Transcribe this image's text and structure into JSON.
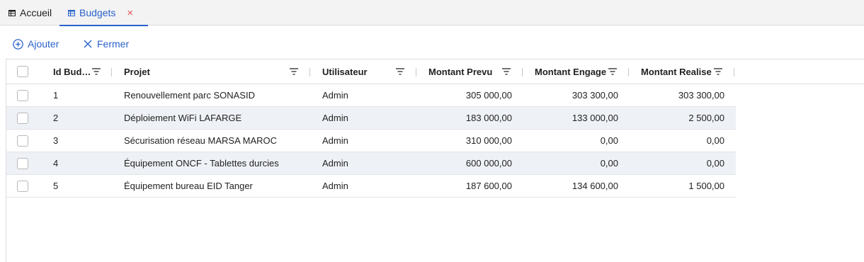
{
  "tabs": [
    {
      "label": "Accueil",
      "icon": "table-icon"
    },
    {
      "label": "Budgets",
      "icon": "table-icon",
      "close": "×"
    }
  ],
  "toolbar": {
    "add_label": "Ajouter",
    "close_label": "Fermer"
  },
  "columns": [
    "Id Bud…",
    "Projet",
    "Utilisateur",
    "Montant Prevu",
    "Montant Engage",
    "Montant Realise"
  ],
  "rows": [
    {
      "id": "1",
      "projet": "Renouvellement parc SONASID",
      "utilisateur": "Admin",
      "prevu": "305 000,00",
      "engage": "303 300,00",
      "realise": "303 300,00"
    },
    {
      "id": "2",
      "projet": "Déploiement WiFi LAFARGE",
      "utilisateur": "Admin",
      "prevu": "183 000,00",
      "engage": "133 000,00",
      "realise": "2 500,00"
    },
    {
      "id": "3",
      "projet": "Sécurisation réseau MARSA MAROC",
      "utilisateur": "Admin",
      "prevu": "310 000,00",
      "engage": "0,00",
      "realise": "0,00"
    },
    {
      "id": "4",
      "projet": "Équipement ONCF - Tablettes durcies",
      "utilisateur": "Admin",
      "prevu": "600 000,00",
      "engage": "0,00",
      "realise": "0,00"
    },
    {
      "id": "5",
      "projet": "Équipement bureau EID Tanger",
      "utilisateur": "Admin",
      "prevu": "187 600,00",
      "engage": "134 600,00",
      "realise": "1 500,00"
    }
  ],
  "colors": {
    "accent": "#2a63c9",
    "close": "#e15050",
    "alt_row": "#eef1f5"
  }
}
